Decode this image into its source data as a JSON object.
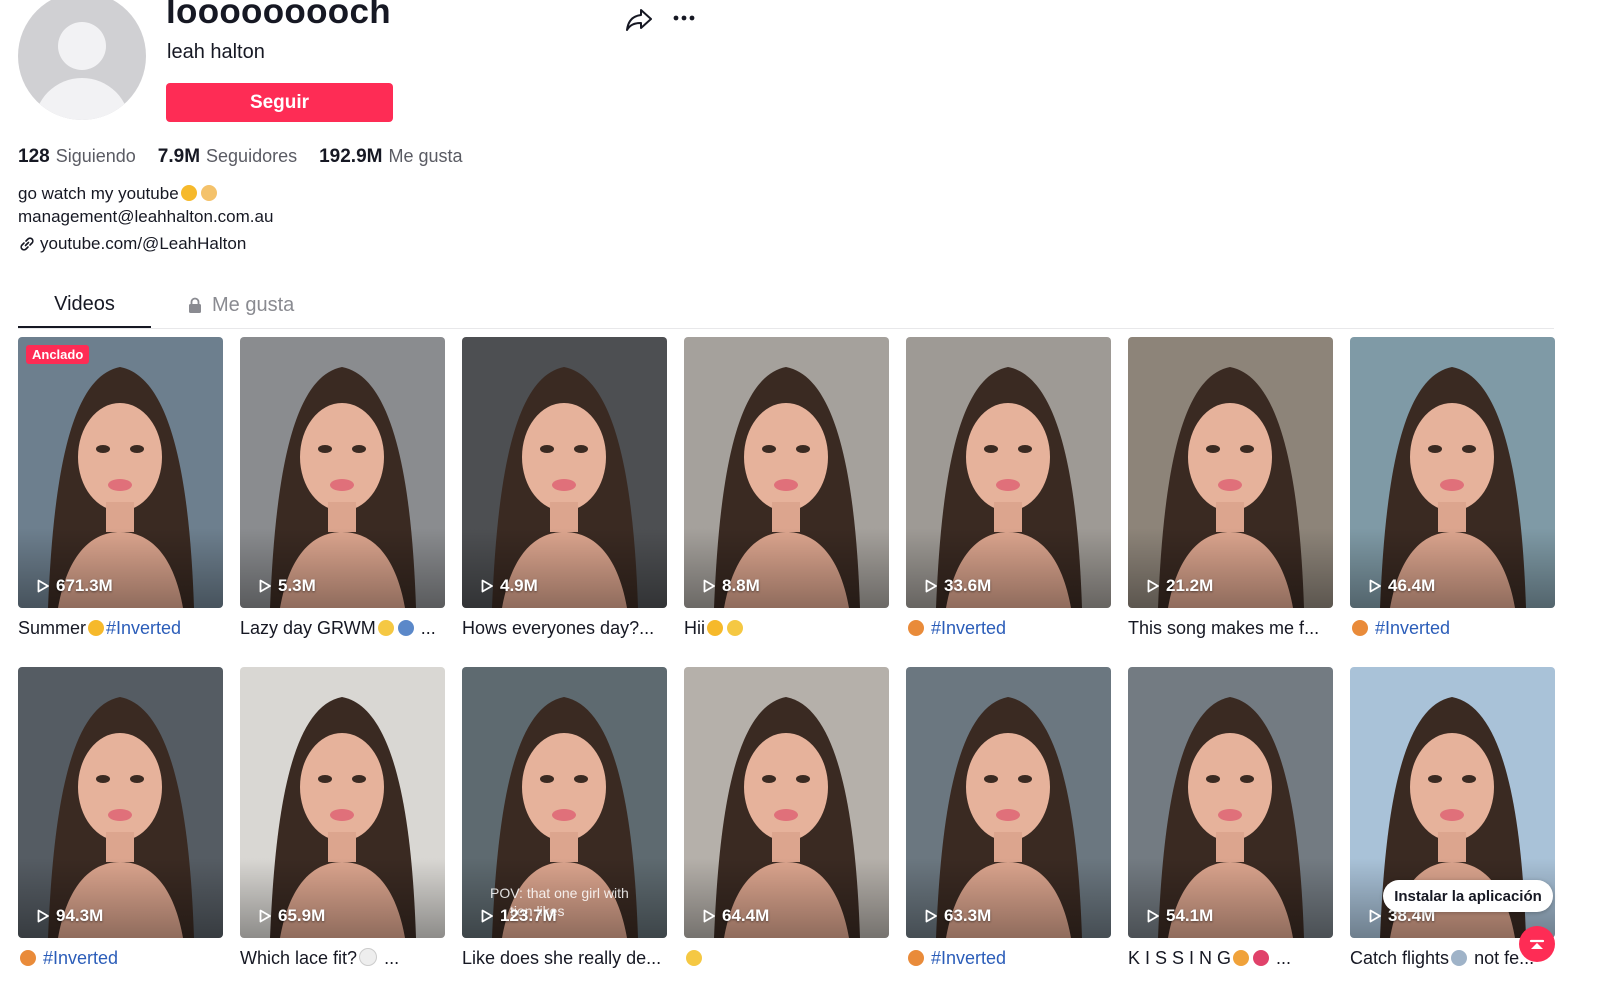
{
  "profile": {
    "username": "looooooooch",
    "nickname": "leah halton",
    "follow_label": "Seguir",
    "stats": {
      "following_count": "128",
      "following_label": "Siguiendo",
      "followers_count": "7.9M",
      "followers_label": "Seguidores",
      "likes_count": "192.9M",
      "likes_label": "Me gusta"
    },
    "bio_line1": "go watch my youtube",
    "bio_line2": "management@leahhalton.com.au",
    "link": "youtube.com/@LeahHalton"
  },
  "tabs": {
    "videos": "Videos",
    "liked": "Me gusta"
  },
  "pinned_label": "Anclado",
  "videos": [
    {
      "views": "671.3M",
      "caption": "Summer",
      "hashtag": "#Inverted",
      "bg": "#6d7f8e",
      "pinned": true
    },
    {
      "views": "5.3M",
      "caption": "Lazy day GRWM",
      "trail": "...",
      "bg": "#8a8c8f"
    },
    {
      "views": "4.9M",
      "caption": "Hows everyones day?...",
      "bg": "#4d4f52"
    },
    {
      "views": "8.8M",
      "caption": "Hii",
      "bg": "#a5a19c"
    },
    {
      "views": "33.6M",
      "caption": "",
      "hashtag": "#Inverted",
      "bg": "#9e9a95"
    },
    {
      "views": "21.2M",
      "caption": "This song makes me f...",
      "bg": "#8d8479"
    },
    {
      "views": "46.4M",
      "caption": "",
      "hashtag": "#Inverted",
      "bg": "#7f9aa6"
    },
    {
      "views": "94.3M",
      "caption": "",
      "hashtag": "#Inverted",
      "bg": "#555c63"
    },
    {
      "views": "65.9M",
      "caption": "Which lace fit?",
      "trail": "...",
      "bg": "#d9d7d3"
    },
    {
      "views": "123.7M",
      "caption": "Like does she really de...",
      "bg": "#5e6a70",
      "overlay1": "POV: that one girl with",
      "overlay2": "tion likes"
    },
    {
      "views": "64.4M",
      "caption": "",
      "bg": "#b5b0aa"
    },
    {
      "views": "63.3M",
      "caption": "",
      "hashtag": "#Inverted",
      "bg": "#6b7780"
    },
    {
      "views": "54.1M",
      "caption": "K I S S I N G",
      "trail": "...",
      "bg": "#737b82"
    },
    {
      "views": "38.4M",
      "caption": "Catch flights",
      "trail": "not fe...",
      "bg": "#a9c2d8"
    }
  ],
  "install_app": "Instalar la aplicación",
  "icons": {
    "share": "share-icon",
    "more": "more-icon",
    "link": "link-icon",
    "lock": "lock-icon",
    "play": "play-icon",
    "scroll_top": "scroll-top-icon"
  },
  "colors": {
    "brand": "#fe2c55",
    "hashtag": "#2b5db9",
    "text": "#161823",
    "muted": "#5a5b63"
  }
}
